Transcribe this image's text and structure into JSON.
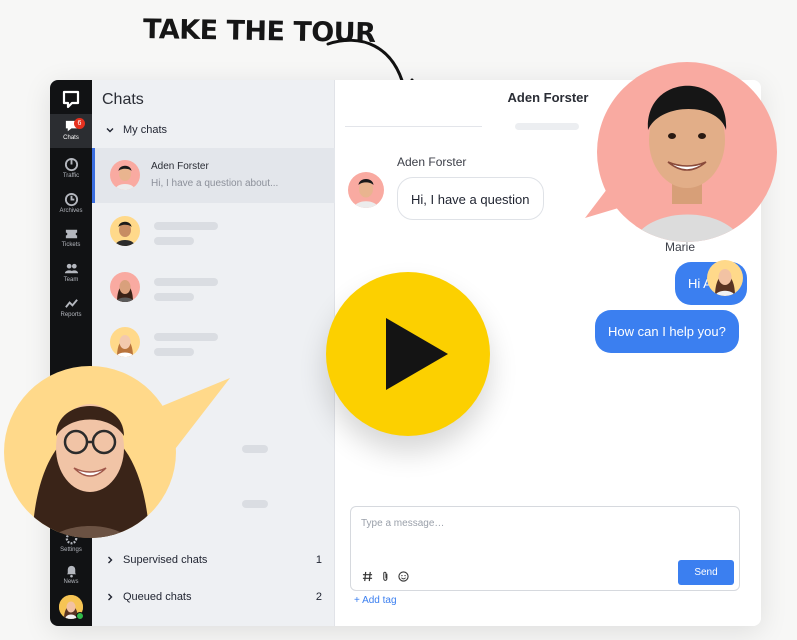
{
  "tour": {
    "label": "TAKE THE TOUR"
  },
  "sidebar": {
    "items": [
      {
        "label": "Chats",
        "icon": "chats-icon",
        "badge": "6",
        "active": true
      },
      {
        "label": "Traffic",
        "icon": "traffic-icon"
      },
      {
        "label": "Archives",
        "icon": "archives-icon"
      },
      {
        "label": "Tickets",
        "icon": "tickets-icon"
      },
      {
        "label": "Team",
        "icon": "team-icon"
      },
      {
        "label": "Reports",
        "icon": "reports-icon"
      },
      {
        "label": "Settings",
        "icon": "settings-icon"
      },
      {
        "label": "News",
        "icon": "news-icon"
      }
    ]
  },
  "chat_list": {
    "title": "Chats",
    "my_chats_label": "My chats",
    "active_chat": {
      "name": "Aden Forster",
      "preview": "Hi, I have a question about..."
    },
    "supervised": {
      "label": "Supervised chats",
      "count": "1"
    },
    "queued": {
      "label": "Queued chats",
      "count": "2"
    }
  },
  "conversation": {
    "title": "Aden Forster",
    "messages": [
      {
        "sender": "Aden Forster",
        "text": "Hi, I have a question",
        "direction": "in"
      },
      {
        "sender": "Marie",
        "text": "Hi Aden",
        "direction": "out"
      },
      {
        "sender": "Marie",
        "text": "How can I help you?",
        "direction": "out"
      }
    ]
  },
  "composer": {
    "placeholder": "Type a message…",
    "send_label": "Send",
    "add_tag_label": "+ Add tag"
  },
  "colors": {
    "accent_blue": "#3b7ff0",
    "play_yellow": "#fcd000",
    "sidebar_dark": "#111214",
    "bubble_pink": "#f9aaa1",
    "bubble_peach": "#ffd98a"
  }
}
